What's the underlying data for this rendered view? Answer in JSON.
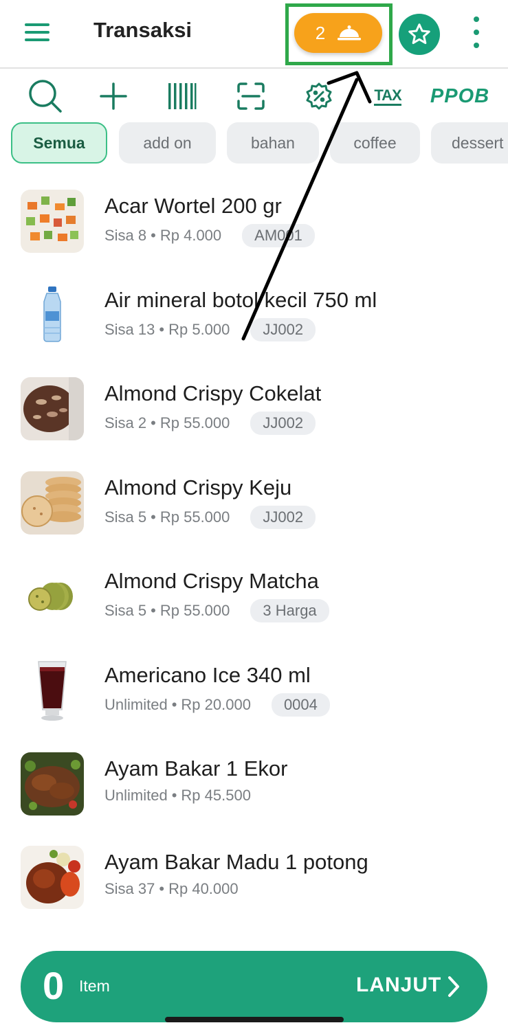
{
  "header": {
    "title": "Transaksi",
    "order_count": "2",
    "menu_icon": "hamburger-icon",
    "order_icon": "cloche-icon",
    "star_icon": "star-icon",
    "more_icon": "more-vertical-icon"
  },
  "toolbar": {
    "tools": [
      "search-icon",
      "add-icon",
      "barcode-icon",
      "scan-icon",
      "discount-icon",
      "tax-icon",
      "ppob-icon"
    ],
    "tax_label": "TAX",
    "ppob_label": "PPOB"
  },
  "categories": {
    "selected": "Semua",
    "items": [
      "Semua",
      "add on",
      "bahan",
      "coffee",
      "dessert"
    ]
  },
  "products": [
    {
      "name": "Acar Wortel 200 gr",
      "stock": "Sisa 8",
      "price": "Rp 4.000",
      "code": "AM001"
    },
    {
      "name": "Air mineral botol kecil 750 ml",
      "stock": "Sisa 13",
      "price": "Rp 5.000",
      "code": "JJ002"
    },
    {
      "name": "Almond Crispy Cokelat",
      "stock": "Sisa 2",
      "price": "Rp 55.000",
      "code": "JJ002"
    },
    {
      "name": "Almond Crispy Keju",
      "stock": "Sisa 5",
      "price": "Rp 55.000",
      "code": "JJ002"
    },
    {
      "name": "Almond Crispy Matcha",
      "stock": "Sisa 5",
      "price": "Rp 55.000",
      "code": "3 Harga"
    },
    {
      "name": "Americano Ice 340 ml",
      "stock": "Unlimited",
      "price": "Rp 20.000",
      "code": "0004"
    },
    {
      "name": "Ayam Bakar 1 Ekor",
      "stock": "Unlimited",
      "price": "Rp 45.500",
      "code": ""
    },
    {
      "name": "Ayam Bakar Madu 1 potong",
      "stock": "Sisa 37",
      "price": "Rp 40.000",
      "code": ""
    }
  ],
  "meta_separator": "•",
  "bottom_bar": {
    "count": "0",
    "item_label": "Item",
    "next_label": "LANJUT"
  },
  "colors": {
    "primary": "#1ea27b",
    "accent": "#f7a21b",
    "highlight_box": "#2fa84a"
  }
}
